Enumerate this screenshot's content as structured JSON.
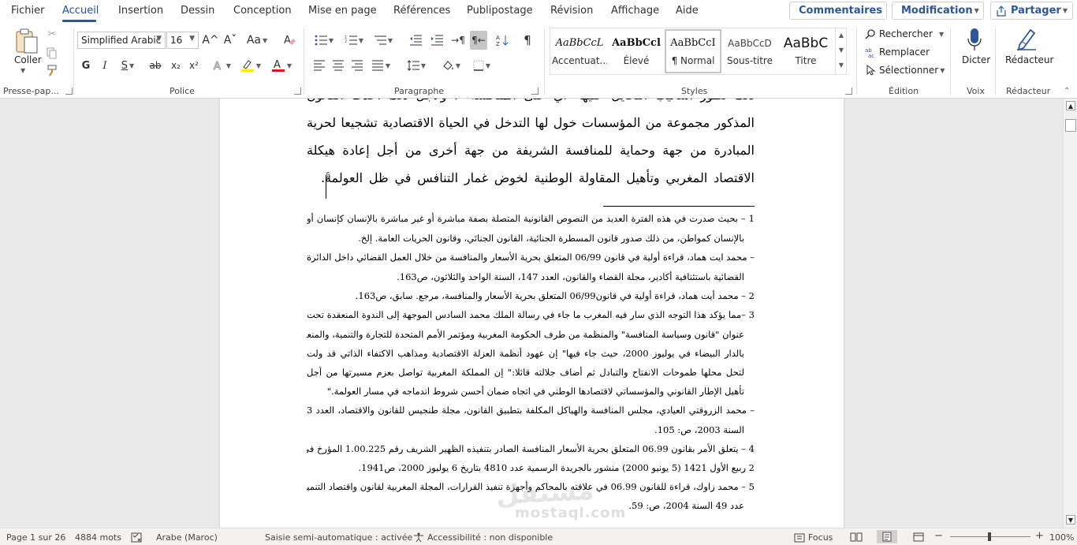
{
  "menu": {
    "tabs": [
      "Fichier",
      "Accueil",
      "Insertion",
      "Dessin",
      "Conception",
      "Mise en page",
      "Références",
      "Publipostage",
      "Révision",
      "Affichage",
      "Aide"
    ],
    "active": "Accueil",
    "comments_label": "Commentaires",
    "editing_label": "Modification",
    "share_label": "Partager"
  },
  "ribbon": {
    "clipboard": {
      "paste_label": "Coller",
      "group_label": "Presse-pap..."
    },
    "font": {
      "name": "Simplified Arabic",
      "size": "16",
      "group_label": "Police",
      "bold": "G",
      "italic": "I",
      "underline": "S",
      "strike": "ab",
      "sub": "x₂",
      "sup": "x²",
      "grow": "A^",
      "shrink": "Aˇ",
      "case": "Aa",
      "clear": "A"
    },
    "paragraph": {
      "group_label": "Paragraphe"
    },
    "styles": {
      "group_label": "Styles",
      "items": [
        {
          "preview": "AaBbCcL",
          "label": "Accentuat..."
        },
        {
          "preview": "AaBbCcl",
          "label": "Élevé"
        },
        {
          "preview": "AaBbCcI",
          "label": "¶ Normal"
        },
        {
          "preview": "AaBbCcD",
          "label": "Sous-titre"
        },
        {
          "preview": "AaBbC",
          "label": "Titre"
        }
      ]
    },
    "editing": {
      "group_label": "Édition",
      "find": "Rechercher",
      "replace": "Remplacer",
      "select": "Sélectionner"
    },
    "voice": {
      "group_label": "Voix",
      "dictate": "Dicter"
    },
    "editor": {
      "group_label": "Rédacteur",
      "label": "Rédacteur"
    }
  },
  "document": {
    "body_lines": [
      "ذلك تطور أساليب التحايل عليها- أي على المنافسة -، ولأجل ذلك أحدث القانون",
      "المذكور مجموعة من المؤسسات خول لها التدخل في الحياة الاقتصادية تشجيعا لحرية",
      "المبادرة من جهة وحماية للمنافسة الشريفة من جهة أخرى من أجل إعادة هيكلة",
      "الاقتصاد المغربي وتأهيل المقاولة الوطنية لخوض غمار التنافس في ظل العولمة."
    ],
    "footnote_ref": "5",
    "footnotes": [
      {
        "text": "1 – بحيث صدرت في هذه الفترة العديد من النصوص القانونية المتصلة بصفة مباشرة أو غير مباشرة بالإنسان كإنسان أو",
        "j": true
      },
      {
        "text": "بالإنسان كمواطن، من ذلك صدور قانون المسطرة الجنائية، القانون الجنائي، وقانون الحريات العامة. إلخ.",
        "j": false
      },
      {
        "text": "– محمد ايت هماد، قراءة أولية في قانون 06/99 المتعلق بحرية الأسعار والمنافسة من خلال العمل القضائي داخل الدائرة",
        "j": true
      },
      {
        "text": "القضائية باستئنافية أكادير، مجلة القضاء والقانون، العدد 147، السنة الواحد والثلاثون، ص163.",
        "j": false
      },
      {
        "text": "2 – محمد أيت هماد، قراءة أولية في قانون06/99 المتعلق بحرية الأسعار والمنافسة، مرجع. سابق، ص163.",
        "j": false
      },
      {
        "text": "3 –مما يؤكد هذا التوجه الذي سار فيه المغرب ما جاء في رسالة الملك محمد السادس الموجهة إلى الندوة المنعقدة تحت",
        "j": true
      },
      {
        "text": "عنوان \"قانون وسياسة المنافسة\" والمنظمة من طرف الحكومة المغربية ومؤتمر الأمم المتحدة للتجارة والتنمية، والمنعقدة",
        "j": true
      },
      {
        "text": "بالدار البيضاء في يوليوز 2000، حيث جاء فيها\" إن عهود أنظمة العزلة الاقتصادية ومذاهب الاكتفاء الذاتي قد ولت",
        "j": true
      },
      {
        "text": "لتحل محلها طموحات الانفتاح والتبادل ثم أضاف جلالته قائلا:\" إن المملكة المغربية تواصل بعزم مسيرتها من أجل",
        "j": true
      },
      {
        "text": "تأهيل الإطار القانوني والمؤسساتي لاقتصادها الوطني في اتجاه ضمان أحسن شروط اندماجه في مسار العولمة.\"",
        "j": false
      },
      {
        "text": "– محمد الزروقتي العيادي، مجلس المنافسة والهياكل المكلفة بتطبيق القانون، مجلة طنجيس للقانون والاقتصاد، العدد 3",
        "j": true
      },
      {
        "text": "السنة 2003، ص: 105.",
        "j": false
      },
      {
        "text": "4 – يتعلق الأمر بقانون 06.99 المتعلق بحرية الأسعار المنافسة الصادر بتنفيذه الظهير الشريف رقم 1.00.225 المؤرخ في",
        "j": true
      },
      {
        "text": "2 ربيع الأول 1421 (5 يونيو 2000) منشور بالجريدة الرسمية عدد 4810 بتاريخ 6 يوليوز 2000، ص1941.",
        "j": false
      },
      {
        "text": "5 – محمد زاوك، قراءة للقانون 06.99 في علاقته بالمحاكم وأجهزة تنفيذ القرارات، المجلة المغربية لقانون واقتصاد التنمية،",
        "j": true
      },
      {
        "text": "عدد 49 السنة 2004، ص: 59.",
        "j": false
      }
    ],
    "watermark": "مستقل",
    "watermark_sub": "mostaql.com"
  },
  "status": {
    "page": "Page 1 sur 26",
    "words": "4884 mots",
    "language": "Arabe (Maroc)",
    "autocomplete": "Saisie semi-automatique : activée",
    "accessibility": "Accessibilité : non disponible",
    "focus": "Focus",
    "zoom": "100%"
  }
}
